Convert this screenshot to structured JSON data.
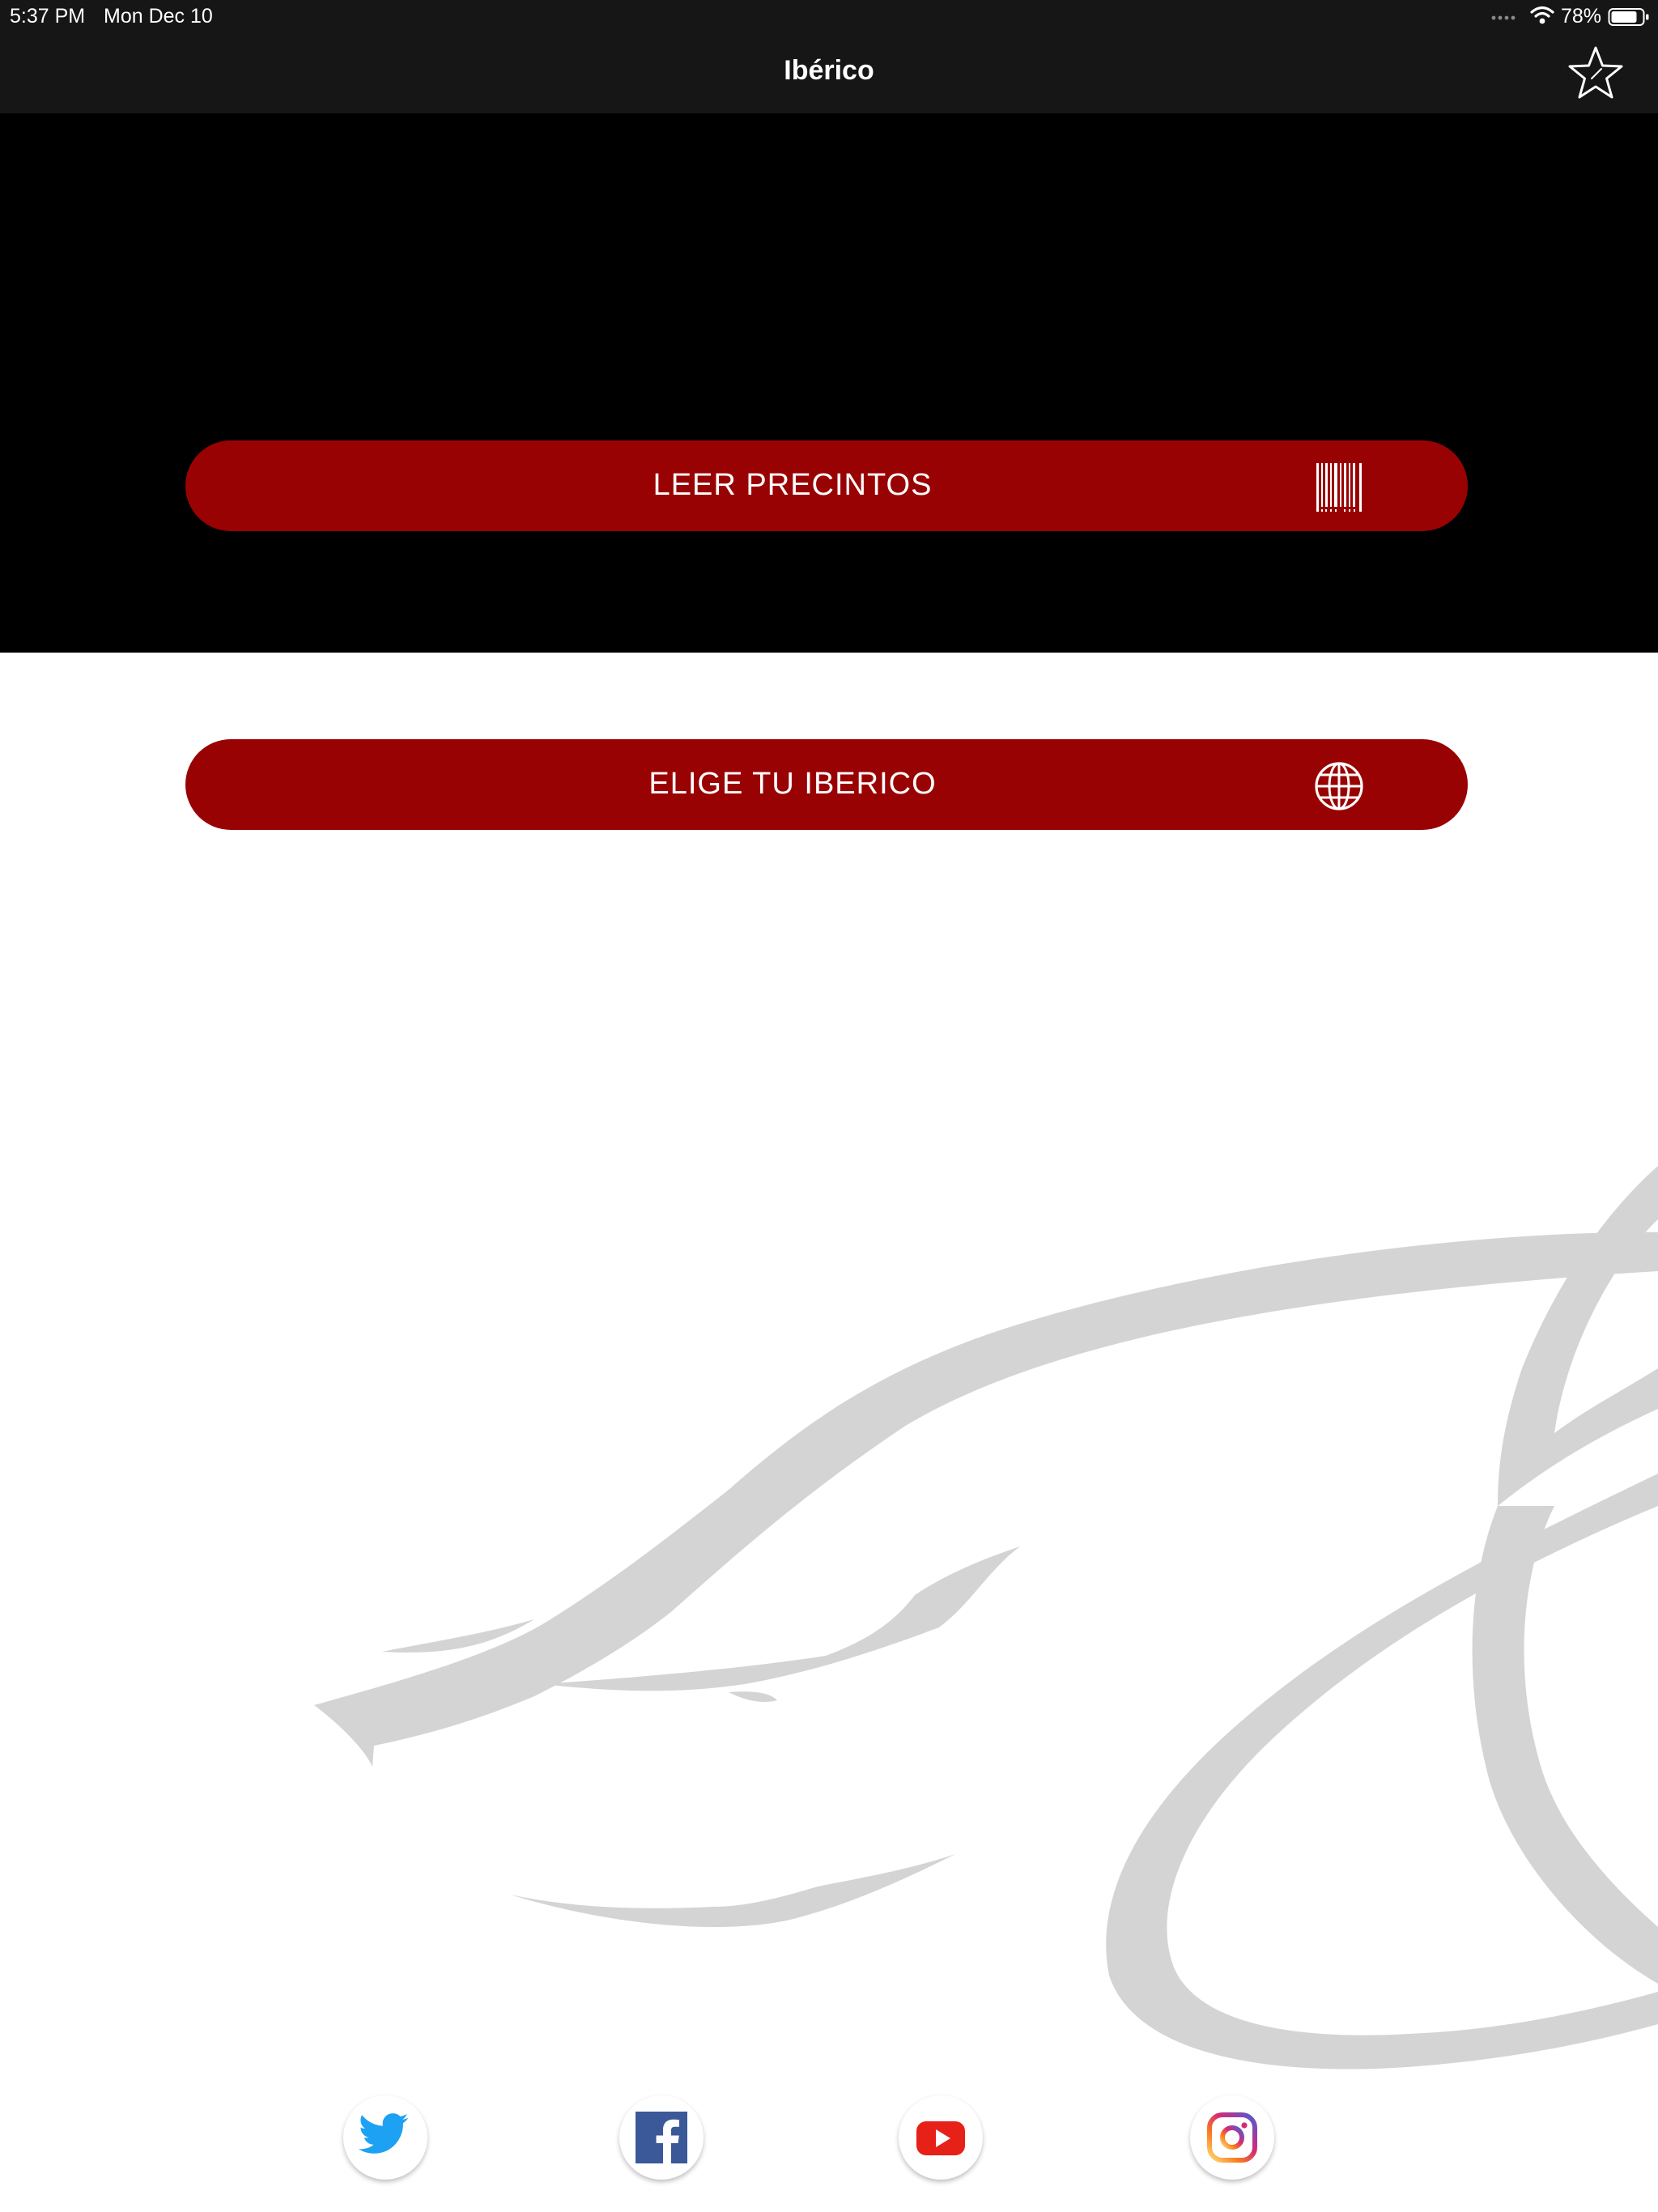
{
  "status_bar": {
    "time": "5:37 PM",
    "date": "Mon Dec 10",
    "battery": "78%",
    "icons": [
      "cellular-signal-icon",
      "wifi-icon",
      "battery-icon"
    ]
  },
  "nav": {
    "title": "Ibérico",
    "right_icon": "star-icon"
  },
  "buttons": {
    "leer": {
      "label": "LEER PRECINTOS",
      "icon": "barcode-icon"
    },
    "elige": {
      "label": "ELIGE TU IBERICO",
      "icon": "globe-icon"
    }
  },
  "social": [
    {
      "name": "Twitter",
      "icon": "twitter-icon"
    },
    {
      "name": "Facebook",
      "icon": "facebook-icon"
    },
    {
      "name": "YouTube",
      "icon": "youtube-icon"
    },
    {
      "name": "Instagram",
      "icon": "instagram-icon"
    }
  ],
  "colors": {
    "bar_background": "#161616",
    "hero_background": "#000000",
    "button_red": "#990203",
    "watermark_gray": "#d4d4d4",
    "twitter_blue": "#1da1f2",
    "facebook_blue": "#3b5998",
    "youtube_red": "#e62117"
  }
}
